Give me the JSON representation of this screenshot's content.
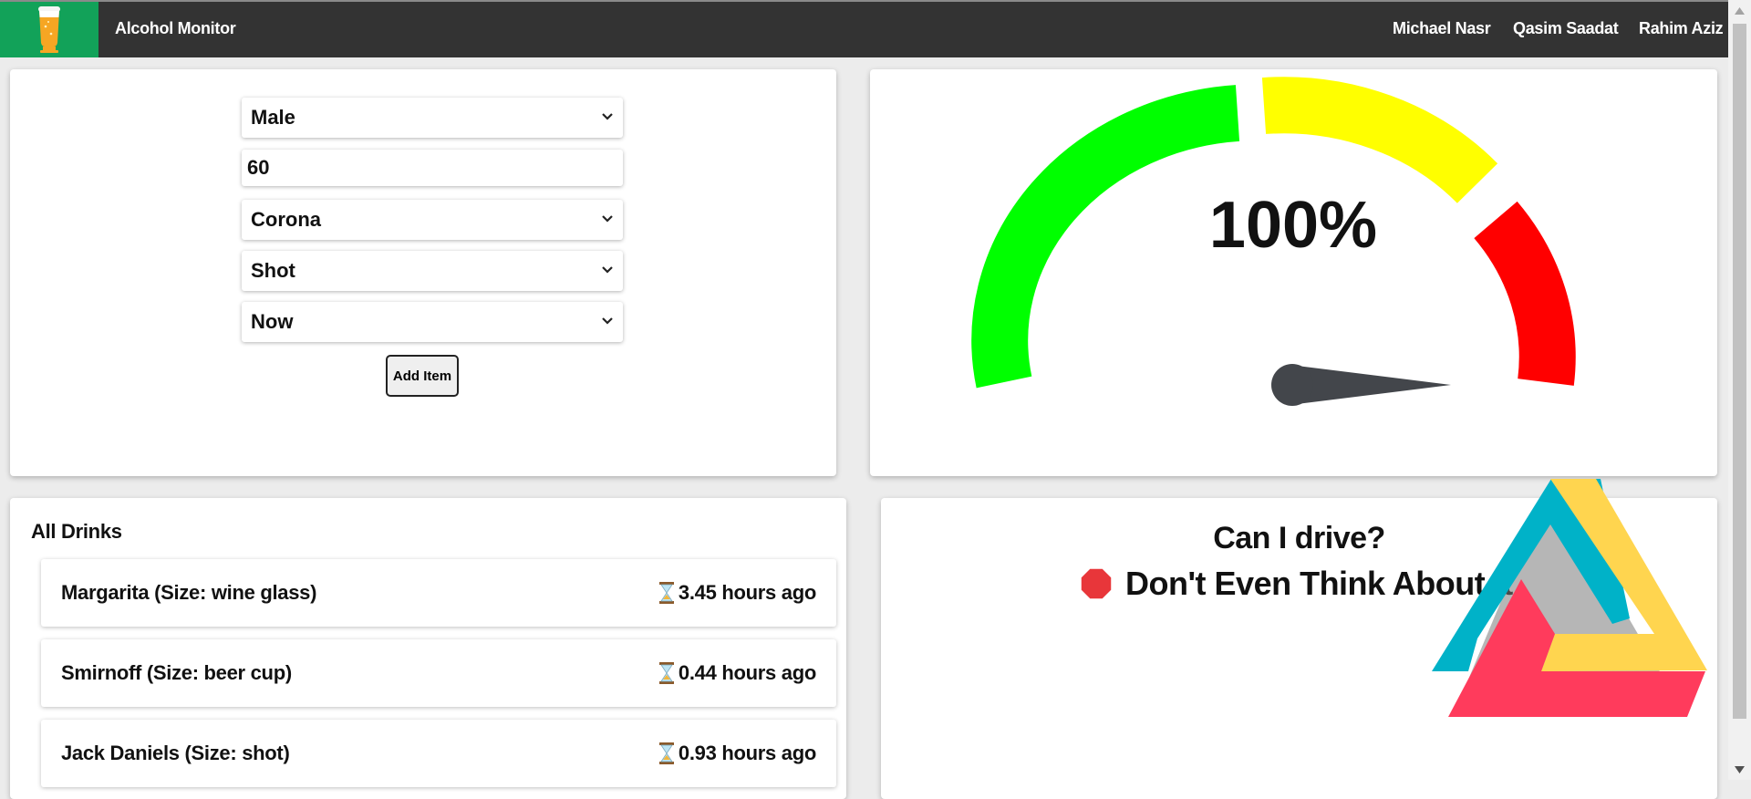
{
  "header": {
    "app_title": "Alcohol Monitor",
    "links": [
      "Michael Nasr",
      "Qasim Saadat",
      "Rahim Aziz"
    ],
    "brand_color": "#12a259",
    "bar_color": "#333333"
  },
  "form": {
    "gender": "Male",
    "weight": "60",
    "drink": "Corona",
    "size": "Shot",
    "time": "Now",
    "add_button": "Add Item"
  },
  "gauge": {
    "value_label": "100%",
    "value": 100,
    "segment_colors": [
      "#00ff00",
      "#ffff00",
      "#ff0000"
    ],
    "needle_color": "#43464b"
  },
  "drinks": {
    "title": "All Drinks",
    "items": [
      {
        "name": "Margarita (Size: wine glass)",
        "time": "3.45 hours ago"
      },
      {
        "name": "Smirnoff (Size: beer cup)",
        "time": "0.44 hours ago"
      },
      {
        "name": "Jack Daniels (Size: shot)",
        "time": "0.93 hours ago"
      }
    ],
    "time_icon": "hourglass-icon"
  },
  "drive": {
    "question": "Can I drive?",
    "verdict": "Don't Even Think About It",
    "status_icon": "stop-sign-icon",
    "status_color": "#e8363a"
  },
  "overlay_logo": {
    "icon": "impossible-triangle-logo",
    "colors": [
      "#00b2c8",
      "#ffd54f",
      "#ff3b5c"
    ]
  }
}
